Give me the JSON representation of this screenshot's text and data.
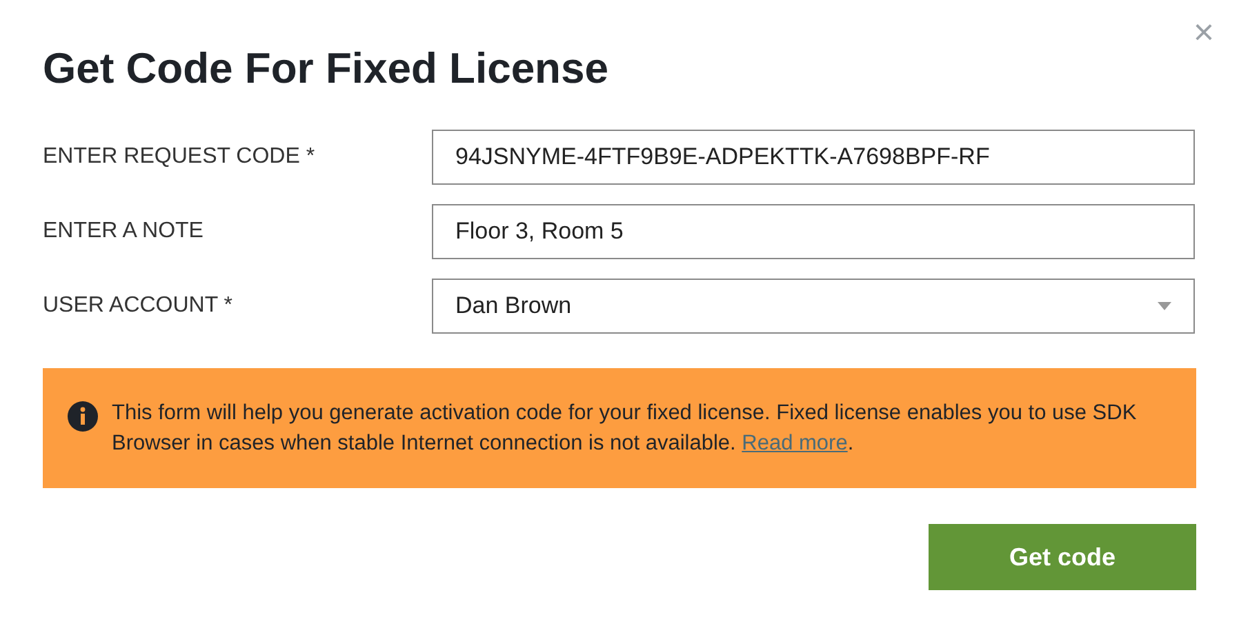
{
  "dialog": {
    "title": "Get Code For Fixed License",
    "close": "×"
  },
  "fields": [
    {
      "kind": "input",
      "label": "ENTER REQUEST CODE *",
      "value": "94JSNYME-4FTF9B9E-ADPEKTTK-A7698BPF-RF"
    },
    {
      "kind": "input",
      "label": "ENTER A NOTE",
      "value": "Floor 3, Room 5"
    },
    {
      "kind": "select",
      "label": "USER ACCOUNT *",
      "value": "Dan Brown"
    }
  ],
  "notice": {
    "text": "This form will help you generate activation code for your fixed license. Fixed license enables you to use SDK Browser in cases when stable Internet connection is not available. ",
    "link": "Read more",
    "after": "."
  },
  "buttons": [
    "Get code"
  ]
}
